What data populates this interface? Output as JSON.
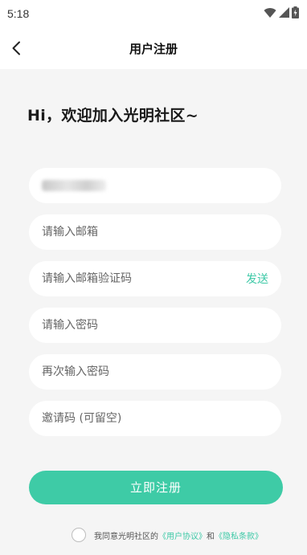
{
  "status_bar": {
    "time": "5:18"
  },
  "nav": {
    "title": "用户注册"
  },
  "greeting": "Hi，欢迎加入光明社区~",
  "form": {
    "username": {
      "value": "",
      "redacted": true
    },
    "email": {
      "placeholder": "请输入邮箱"
    },
    "email_code": {
      "placeholder": "请输入邮箱验证码",
      "send_label": "发送"
    },
    "password": {
      "placeholder": "请输入密码"
    },
    "password_confirm": {
      "placeholder": "再次输入密码"
    },
    "invite_code": {
      "placeholder": "邀请码 (可留空)"
    }
  },
  "submit_label": "立即注册",
  "agreement": {
    "prefix": "我同意光明社区的",
    "user_agreement": "《用户协议》",
    "and": "和",
    "privacy_policy": "《隐私条款》",
    "checked": false
  },
  "colors": {
    "accent": "#3ecba6",
    "background": "#f5f5f5",
    "field_bg": "#ffffff"
  }
}
